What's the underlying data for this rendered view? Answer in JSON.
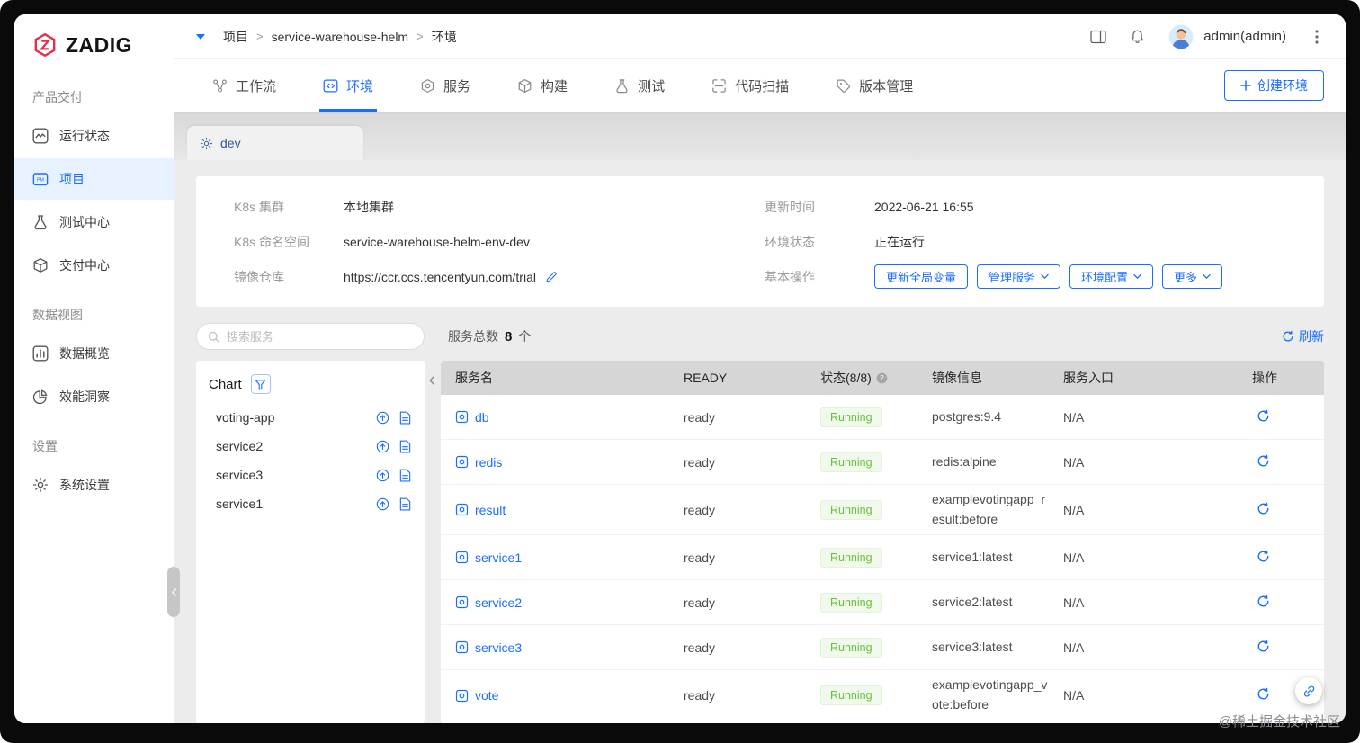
{
  "watermark": "@稀土掘金技术社区",
  "colors": {
    "accent": "#1a6eff",
    "logo_red": "#e6304a",
    "running_text": "#67c23a",
    "running_bg": "#f0f9eb",
    "active_item_bg": "#e8f1ff",
    "table_header_bg": "#d6d6d6"
  },
  "sidebar": {
    "logo_text": "ZADIG",
    "sections": [
      {
        "title": "产品交付",
        "items": [
          {
            "label": "运行状态",
            "icon": "status",
            "active": false
          },
          {
            "label": "项目",
            "icon": "project",
            "active": true
          },
          {
            "label": "测试中心",
            "icon": "test",
            "active": false
          },
          {
            "label": "交付中心",
            "icon": "delivery",
            "active": false
          }
        ]
      },
      {
        "title": "数据视图",
        "items": [
          {
            "label": "数据概览",
            "icon": "overview",
            "active": false
          },
          {
            "label": "效能洞察",
            "icon": "insight",
            "active": false
          }
        ]
      },
      {
        "title": "设置",
        "items": [
          {
            "label": "系统设置",
            "icon": "gear",
            "active": false
          }
        ]
      }
    ]
  },
  "header": {
    "breadcrumb": [
      "项目",
      "service-warehouse-helm",
      "环境"
    ],
    "separator": ">",
    "username": "admin(admin)"
  },
  "tabs": {
    "items": [
      {
        "label": "工作流",
        "icon": "workflow",
        "active": false
      },
      {
        "label": "环境",
        "icon": "env",
        "active": true
      },
      {
        "label": "服务",
        "icon": "service",
        "active": false
      },
      {
        "label": "构建",
        "icon": "build",
        "active": false
      },
      {
        "label": "测试",
        "icon": "test",
        "active": false
      },
      {
        "label": "代码扫描",
        "icon": "scan",
        "active": false
      },
      {
        "label": "版本管理",
        "icon": "version",
        "active": false
      }
    ],
    "create_env_label": "创建环境"
  },
  "env_tab": {
    "label": "dev"
  },
  "env_info": {
    "left": [
      {
        "label": "K8s 集群",
        "value": "本地集群"
      },
      {
        "label": "K8s 命名空间",
        "value": "service-warehouse-helm-env-dev"
      },
      {
        "label": "镜像仓库",
        "value": "https://ccr.ccs.tencentyun.com/trial",
        "editable": true
      }
    ],
    "right": [
      {
        "label": "更新时间",
        "value": "2022-06-21 16:55"
      },
      {
        "label": "环境状态",
        "value": "正在运行"
      },
      {
        "label": "基本操作",
        "buttons": [
          {
            "label": "更新全局变量",
            "dropdown": false
          },
          {
            "label": "管理服务",
            "dropdown": true
          },
          {
            "label": "环境配置",
            "dropdown": true
          },
          {
            "label": "更多",
            "dropdown": true
          }
        ]
      }
    ]
  },
  "toolbar": {
    "search_placeholder": "搜索服务",
    "total_label": "服务总数",
    "total_count": "8",
    "total_unit": "个",
    "refresh_label": "刷新"
  },
  "chart_panel": {
    "title": "Chart",
    "items": [
      {
        "name": "voting-app"
      },
      {
        "name": "service2"
      },
      {
        "name": "service3"
      },
      {
        "name": "service1"
      }
    ]
  },
  "service_table": {
    "columns": [
      "服务名",
      "READY",
      "状态(8/8)",
      "镜像信息",
      "服务入口",
      "操作"
    ],
    "rows": [
      {
        "name": "db",
        "ready": "ready",
        "status": "Running",
        "image": "postgres:9.4",
        "entry": "N/A"
      },
      {
        "name": "redis",
        "ready": "ready",
        "status": "Running",
        "image": "redis:alpine",
        "entry": "N/A"
      },
      {
        "name": "result",
        "ready": "ready",
        "status": "Running",
        "image": "examplevotingapp_result:before",
        "entry": "N/A"
      },
      {
        "name": "service1",
        "ready": "ready",
        "status": "Running",
        "image": "service1:latest",
        "entry": "N/A"
      },
      {
        "name": "service2",
        "ready": "ready",
        "status": "Running",
        "image": "service2:latest",
        "entry": "N/A"
      },
      {
        "name": "service3",
        "ready": "ready",
        "status": "Running",
        "image": "service3:latest",
        "entry": "N/A"
      },
      {
        "name": "vote",
        "ready": "ready",
        "status": "Running",
        "image": "examplevotingapp_vote:before",
        "entry": "N/A"
      }
    ]
  }
}
